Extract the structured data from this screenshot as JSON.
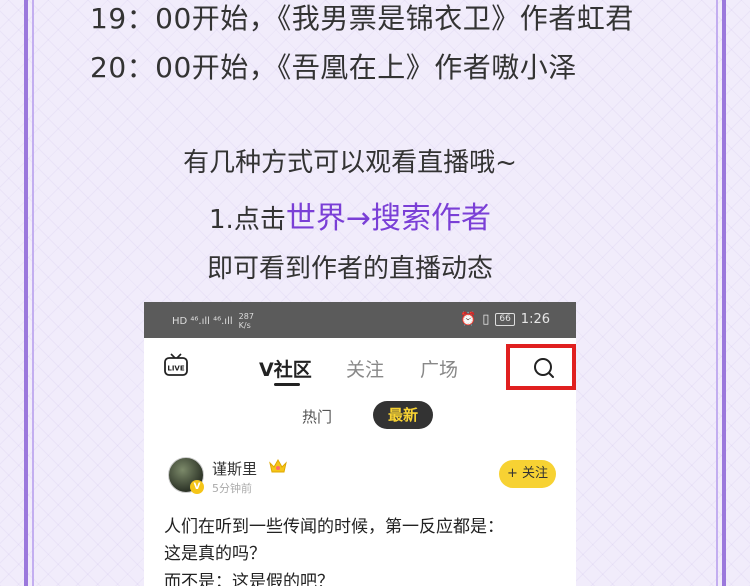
{
  "schedule": [
    "19：00开始，《我男票是锦衣卫》作者虹君",
    "20：00开始，《吾凰在上》作者嗷小泽"
  ],
  "intro": {
    "line1": "有几种方式可以观看直播哦~",
    "step_prefix": "1.点击",
    "step_accent": "世界→搜索作者",
    "line3": "即可看到作者的直播动态"
  },
  "status_bar": {
    "network": "HD ⁴⁶.ıll ⁴⁶.ıll",
    "speed_value": "287",
    "speed_unit": "K/s",
    "battery": "66",
    "time": "1:26"
  },
  "nav": {
    "live_icon_label": "LIVE",
    "tabs": [
      "V社区",
      "关注",
      "广场"
    ],
    "search_icon": "search-icon"
  },
  "filters": {
    "hot": "热门",
    "latest": "最新"
  },
  "post": {
    "username": "谨斯里",
    "badge": "V",
    "time": "5分钟前",
    "follow": "+ 关注",
    "lines": [
      "人们在听到一些传闻的时候，第一反应都是：",
      "这是真的吗？",
      "而不是：这是假的吧？"
    ]
  },
  "colors": {
    "accent_purple": "#7a3fd6",
    "highlight_red": "#e02020",
    "brand_yellow": "#f7d233"
  }
}
